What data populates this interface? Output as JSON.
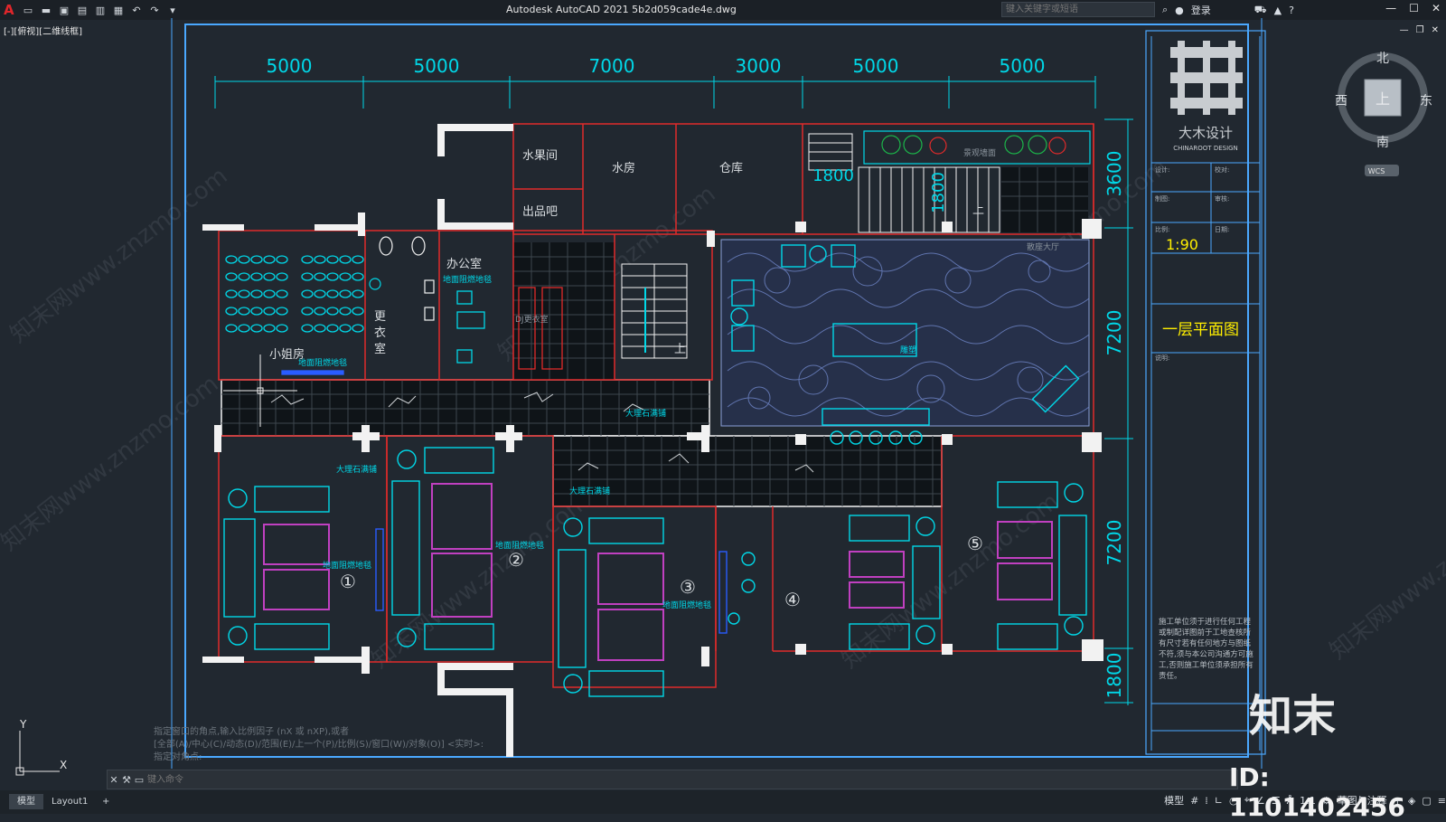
{
  "app": {
    "title": "Autodesk AutoCAD 2021    5b2d059cade4e.dwg",
    "search_placeholder": "键入关键字或短语",
    "login": "登录",
    "viewport_label": "[-][俯视][二维线框]"
  },
  "compass": {
    "north": "北",
    "south": "南",
    "east": "东",
    "west": "西",
    "center": "上",
    "wcs": "WCS"
  },
  "dimensions": {
    "top": [
      "5000",
      "5000",
      "7000",
      "3000",
      "5000",
      "5000"
    ],
    "right": [
      "3600",
      "7200",
      "7200",
      "1800"
    ],
    "stair": [
      "1800",
      "1800"
    ]
  },
  "rooms": {
    "fruit": "水果间",
    "water": "水房",
    "storage": "仓库",
    "bar": "出品吧",
    "office": "办公室",
    "change_1": "更",
    "change_2": "衣",
    "change_3": "室",
    "hostess": "小姐房",
    "dj": "DJ更衣室",
    "up": "上",
    "landscape": "景观墙面",
    "hall": "散座大厅",
    "sculpture": "雕塑"
  },
  "floor_labels": {
    "fireproof": "地面阻燃地毯",
    "marble": "大理石满铺"
  },
  "room_numbers": [
    "①",
    "②",
    "③",
    "④",
    "⑤"
  ],
  "title_block": {
    "brand": "大木设计",
    "brand_en": "CHINAROOT DESIGN",
    "design": "设计:",
    "check": "校对:",
    "draw": "制图:",
    "audit": "审核:",
    "scale_label": "比例:",
    "date_label": "日期:",
    "scale": "1:90",
    "sheet_title": "一层平面图",
    "note_label": "说明:",
    "note": "施工单位须于进行任何工程或制配详图前于工地查核所有尺寸若有任何地方与图纸不符,须与本公司沟通方可施工,否则施工单位须承担所有责任。"
  },
  "command": {
    "history": [
      "指定窗口的角点,输入比例因子 (nX 或 nXP),或者",
      "[全部(A)/中心(C)/动态(D)/范围(E)/上一个(P)/比例(S)/窗口(W)/对象(O)] <实时>:",
      "指定对角点:"
    ],
    "placeholder": "键入命令"
  },
  "tabs": [
    "模型",
    "Layout1",
    "+"
  ],
  "status": {
    "model": "模型",
    "scale": "1:1",
    "workspace": "草图与注释"
  },
  "watermark": {
    "brand": "知末",
    "id": "ID: 1101402456",
    "site": "知末网www.znzmo.com"
  },
  "colors": {
    "wall": "#e02a2a",
    "cyan": "#00d8e8",
    "magenta": "#c040c0",
    "frame": "#4aa8ff",
    "yellow": "#ffee00"
  }
}
